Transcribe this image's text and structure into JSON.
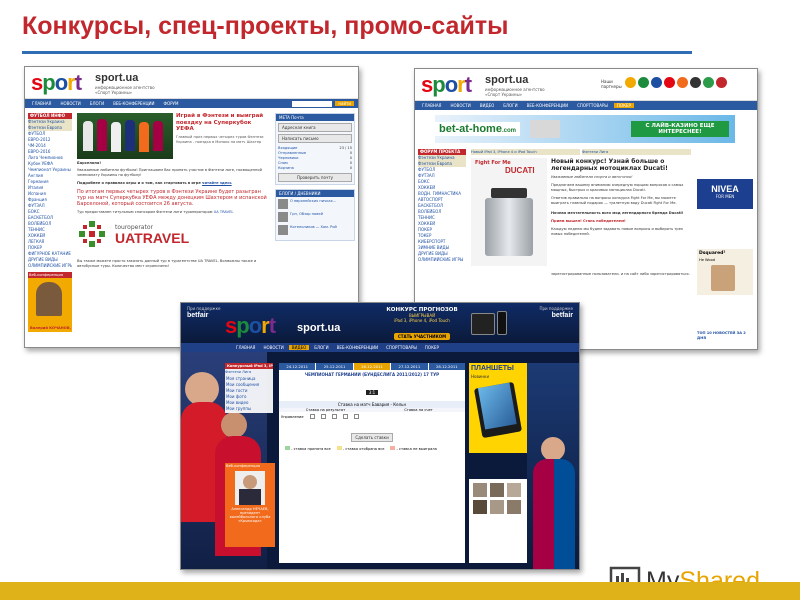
{
  "slide": {
    "title": "Конкурсы, спец-проекты, промо-сайты"
  },
  "watermark": {
    "brand_prefix": "My",
    "brand_suffix": "Shared",
    "icon": "presentation-board-icon"
  },
  "colors": {
    "title": "#c1272d",
    "rule": "#2f6db5",
    "bottom_bar": "#e0b219",
    "nav": "#2c5aa0"
  },
  "shot1": {
    "site_name": "sport.ua",
    "site_sub": "информационное агентство «Спорт Украины»",
    "nav": [
      "ГЛАВНАЯ",
      "НОВОСТИ",
      "БЛОГИ",
      "ВЕБ-КОНФЕРЕНЦИИ",
      "ФОРУМ"
    ],
    "sidebar_header": "ФУТБОЛ ИНФО",
    "sidebar": [
      "Фэнтези Украина",
      "Фэнтези Европа",
      "ФУТБОЛ",
      "ЕВРО-2012",
      "ЧМ-2014",
      "ЕВРО-2016",
      "Лига Чемпионов",
      "Кубок УЕФА",
      "Чемпионат Украины",
      "Англия",
      "Германия",
      "Италия",
      "Испания",
      "Франция",
      "ФУТЗАЛ",
      "БОКС",
      "БАСКЕТБОЛ",
      "ВОЛЕЙБОЛ",
      "ТЕННИС",
      "ХОККЕЙ",
      "ЛЕГКАЯ",
      "ПОКЕР",
      "ФИГУРНОЕ КАТАНИЕ",
      "ДРУГИЕ ВИДЫ",
      "ОЛИМПИЙСКИЕ ИГРЫ"
    ],
    "headline": "Играй в Фэнтези и выиграй поездку на Суперкубок УЕФА",
    "intro": "Главный приз первых четырех туров Фэнтези Украина - поездка в Монако на матч Шахтер",
    "greeting": "Барселона!",
    "body": "Уважаемые любители футбола! Приглашаем Вас принять участие в Фэнтези лиге, посвященной чемпионату Украины по футболу!",
    "rules": "Подробнее о правилах игры и о том, как стартовать в игре",
    "rules_link": "читайте здесь",
    "prize": "По итогам первых четырех туров в Фэнтези Украине будет разыгран тур на матч Суперкубка УЕФА между донецким Шахтером и испанской Барселоной, который состоится 26 августа.",
    "partner": "Тур предоставлен титульным спонсором Фэнтези лиги туроператором",
    "partner_link": "UA TRAVEL",
    "sponsor_top": "touroperator",
    "sponsor_main": "UATRAVEL",
    "search_label": "найти",
    "mail_header": "META Почта",
    "mail_items": [
      "Адресная книга",
      "Написать письмо"
    ],
    "mail_folders": [
      {
        "name": "Входящие",
        "count": "23 / 15"
      },
      {
        "name": "Отправленные",
        "count": "0"
      },
      {
        "name": "Черновики",
        "count": "0"
      },
      {
        "name": "Спам",
        "count": "0"
      },
      {
        "name": "Корзина",
        "count": "0"
      }
    ],
    "mail_button": "Проверить почту",
    "blogs_header": "БЛОГИ / ДНЕВНИКИ",
    "blog_items": [
      "О европейских пичках...",
      "Грн, Обзор новей",
      "Котельников — Хом. Рой"
    ],
    "promo_badge": "Веб-конференция",
    "promo_person": "Валерий КОЧАНОВ,",
    "footer_text": "Вы также можете просто заказать данный тур в турагентстве UA TRAVEL. Возможны также и автобусные туры. Количество мест ограничено!"
  },
  "shot2": {
    "site_name": "sport.ua",
    "site_sub": "информационное агентство «Спорт Украины»",
    "partners_label": "Наши партнеры",
    "nav": [
      "ГЛАВНАЯ",
      "НОВОСТИ",
      "ВИДЕО",
      "БЛОГИ",
      "ВЕБ-КОНФЕРЕНЦИИ",
      "СПОРТТОВАРЫ",
      "ПОКЕР"
    ],
    "banner_brand": "bet-at-home",
    "banner_domain": ".com",
    "banner_slogan": "С ЛАЙВ-КАЗИНО ЕЩЕ ИНТЕРЕСНЕЕ!",
    "sidebar_header": "ФОРУМ ПРОЕКТА",
    "sidebar": [
      "Фэнтези Украина",
      "Фэнтези Европа",
      "ФУТБОЛ",
      "ФУТЗАЛ",
      "БОКС",
      "ХОККЕЙ",
      "ВОДН. ГИМНАСТИКА",
      "АВТОСПОРТ",
      "БАСКЕТБОЛ",
      "ВОЛЕЙБОЛ",
      "ТЕННИС",
      "ХОККЕЙ",
      "ПОКЕР",
      "ТОКЕР",
      "КИБЕРСПОРТ",
      "ЗИМНИЕ ВИДЫ",
      "ДРУГИЕ ВИДЫ",
      "ОЛИМПИЙСКИЕ ИГРЫ"
    ],
    "tabs": [
      "Новый iPad 3, iPhone 4 и iPod Touch",
      "Фэнтези Лига"
    ],
    "promo_brand": "Fight For Me",
    "promo_brand2": "DUCATI",
    "headline": "Новый конкурс! Узнай больше о легендарных мотоциклах Ducati!",
    "intro": "Уважаемые любители спорта и автогонок!",
    "body": "Предлагаем вашему вниманию очередную порцию вопросов о самых мощных, быстрых и красивых мотоциклах Ducati.",
    "body2": "Ответив правильно на вопросы конкурса Fight For Me, вы можете выиграть главный подарок — туалетную воду Ducati Fight For Me.",
    "topic": "Ночная мечтательность всех мод легендарного бренда Ducati!",
    "topic2": "Прием вышел! Стань победителем!",
    "vote": "Каждую неделю мы будем задавать новые вопросы и выбирать трех новых победителей.",
    "side_brand": "NIVEA",
    "side_brand_sub": "FOR MEN",
    "side_brand2": "Dsquared²",
    "side_brand2_sub": "He Wood",
    "side_footer": "ТОП 10 НОВОСТЕЙ ЗА 2 ДНЯ",
    "footer_text": "зарегистрированные пользователи. и на сайт либо зарегистрироваться."
  },
  "shot3": {
    "partner_left": "При поддержке",
    "sponsor_left": "betfair",
    "site_name": "sport.ua",
    "contest_title": "КОНКУРС ПРОГНОЗОВ",
    "contest_sub": "ВЫИГРЫВАЙ",
    "contest_prizes": "iPad 3, iPhone 4, iPod Touch",
    "contest_button": "СТАТЬ УЧАСТНИКОМ",
    "partner_right": "При поддержке",
    "sponsor_right": "betfair",
    "nav": [
      "ГЛАВНАЯ",
      "НОВОСТИ",
      "ВИДЕО",
      "БЛОГИ",
      "ВЕБ-КОНФЕРЕНЦИИ",
      "СПОРТТОВАРЫ",
      "ПОКЕР"
    ],
    "dates": [
      "24.12.2011",
      "25.12.2011",
      "26.12.2011",
      "27.12.2011",
      "28.12.2011"
    ],
    "match_title": "ЧЕМПИОНАТ ГЕРМАНИИ (БУНДЕСЛИГА 2011/2012) 17 ТУР",
    "match_score": "3:1",
    "bet_header": "Ставка на матч Бавария - Кельн",
    "bet_cols": [
      "Ставка на результат",
      "Ставка на счет"
    ],
    "bet_row": "Управление",
    "bet_button": "Сделать ставки",
    "legend": [
      "- ставка принята все",
      "- ставка отобрана все",
      "- ставка не выиграла"
    ],
    "sidebar_menu": [
      "Моя страница",
      "Мои сообщения",
      "Мои гости",
      "Мои фото",
      "Мои видео",
      "Мои группы"
    ],
    "promo_badge": "Веб-конференция",
    "promo_person": "Александр НЕЧАЕВ, президент волейбольного клуба «Крымсода»",
    "tablet_title": "ПЛАНШЕТЫ",
    "tablet_sub": "Новинки",
    "side_links": [
      "Конкурсный iPad 3, iPhone 4 и iPod Touch",
      "Фэнтези Лига"
    ]
  }
}
